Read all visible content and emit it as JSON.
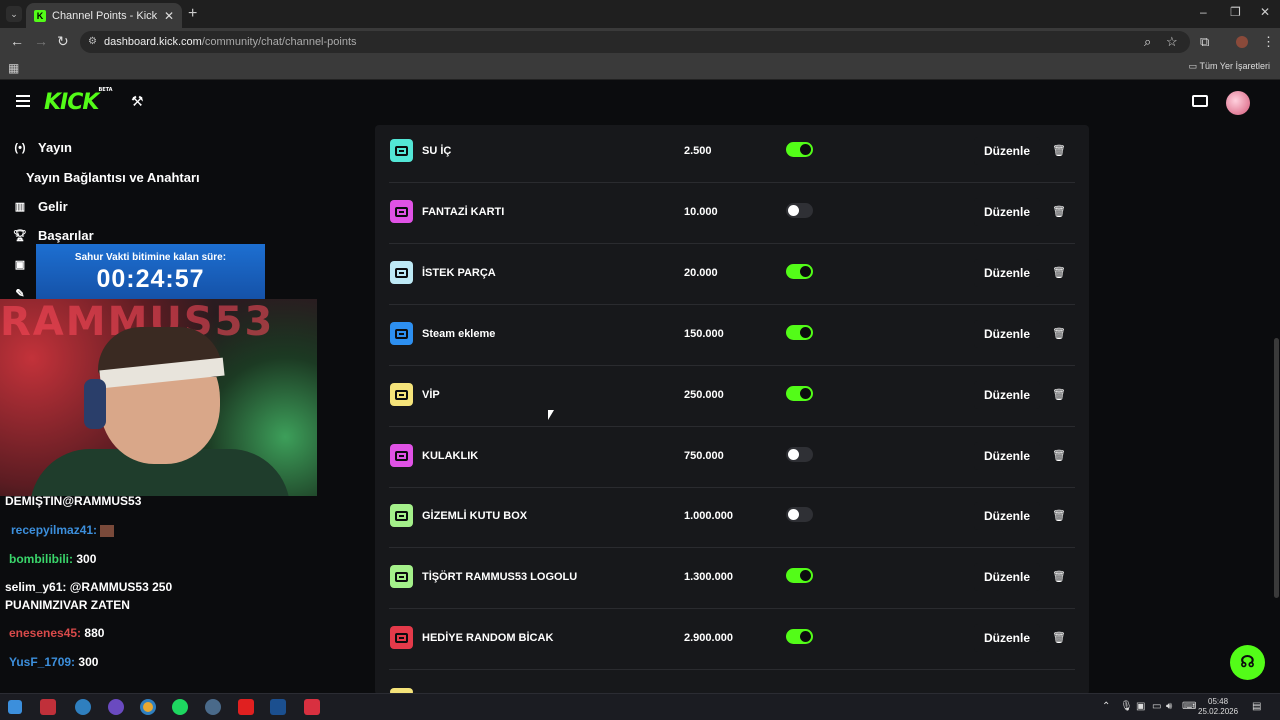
{
  "browser": {
    "tab_title": "Channel Points - Kick Dashboar",
    "url_host": "dashboard.kick.com",
    "url_path": "/community/chat/channel-points",
    "bookmarks_label": "Tüm Yer İşaretleri"
  },
  "header": {
    "logo": "KICK",
    "logo_badge": "BETA"
  },
  "sidebar": {
    "items": [
      {
        "label": "Yayın",
        "icon": "broadcast-icon"
      },
      {
        "label": "Yayın Bağlantısı ve Anahtarı"
      },
      {
        "label": "Gelir",
        "icon": "chart-icon"
      },
      {
        "label": "Başarılar",
        "icon": "trophy-icon"
      }
    ]
  },
  "timer": {
    "caption": "Sahur Vakti bitimine kalan süre:",
    "time": "00:24:57"
  },
  "webcam": {
    "neon_text": "RAMMUS53"
  },
  "chat": [
    {
      "user": "DEMIŞTIN@RAMMUS53",
      "text": "",
      "color": "#ffffff"
    },
    {
      "user": "recepyilmaz41:",
      "text": "",
      "color": "#3c8fdc",
      "emote": true
    },
    {
      "user": "bombilibili:",
      "text": "300",
      "color": "#3ad66b"
    },
    {
      "user": "selim_y61:",
      "text": "@RAMMUS53 250",
      "color": "#ffffff"
    },
    {
      "user": "",
      "text": "PUANIMZIVAR ZATEN",
      "color": "#ffffff"
    },
    {
      "user": "enesenes45:",
      "text": "880",
      "color": "#d84a4a"
    },
    {
      "user": "YusF_1709:",
      "text": "300",
      "color": "#3c8fdc"
    }
  ],
  "rewards": [
    {
      "name": "SU İÇ",
      "cost": "2.500",
      "enabled": true,
      "color": "#53e6d6"
    },
    {
      "name": "FANTAZİ KARTI",
      "cost": "10.000",
      "enabled": false,
      "color": "#e052e6"
    },
    {
      "name": "İSTEK PARÇA",
      "cost": "20.000",
      "enabled": true,
      "color": "#bde9f5"
    },
    {
      "name": "Steam ekleme",
      "cost": "150.000",
      "enabled": true,
      "color": "#2d8ff0"
    },
    {
      "name": "VİP",
      "cost": "250.000",
      "enabled": true,
      "color": "#f5e37a"
    },
    {
      "name": "KULAKLIK",
      "cost": "750.000",
      "enabled": false,
      "color": "#e052e6"
    },
    {
      "name": "GİZEMLİ KUTU BOX",
      "cost": "1.000.000",
      "enabled": false,
      "color": "#a4f08a"
    },
    {
      "name": "TİŞÖRT RAMMUS53 LOGOLU",
      "cost": "1.300.000",
      "enabled": true,
      "color": "#a4f08a"
    },
    {
      "name": "HEDİYE RANDOM BİCAK",
      "cost": "2.900.000",
      "enabled": true,
      "color": "#e43a4a"
    }
  ],
  "edit_label": "Düzenle",
  "taskbar": {
    "time": "05:48",
    "date": "25.02.2026"
  }
}
